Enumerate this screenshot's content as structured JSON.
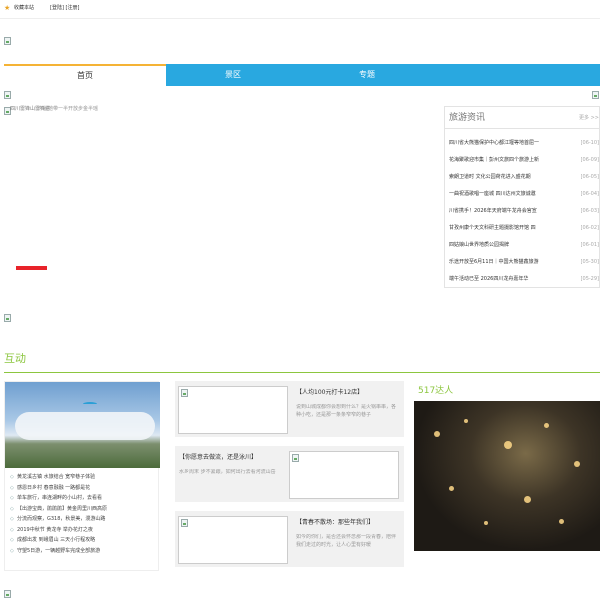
{
  "topbar": {
    "favorite_text": "收藏本站",
    "login_text": "[登陆] [注册]",
    "colors": {
      "favorite_icon": "#e9a426"
    }
  },
  "nav": {
    "items": [
      {
        "label": "首页",
        "active": true
      },
      {
        "label": "景区",
        "active": false
      },
      {
        "label": "专题",
        "active": false
      }
    ],
    "colors": {
      "background": "#29a8e0",
      "active_top": "#f5b335"
    }
  },
  "slider": {
    "caption": "四川雷锋山雷锋塔",
    "caption_b": "环谷地带一半开放步金半瑶"
  },
  "news": {
    "title": "旅游资讯",
    "more": "更多 >>",
    "items": [
      {
        "title": "四川省大熊猫保护中心都江堰等地首屈一",
        "date": "[06-10]"
      },
      {
        "title": "花海聚歌迎市集｜彭州文旅四个旅游上新",
        "date": "[06-09]"
      },
      {
        "title": "索朗卫道时 文化公园荷花进入盛花期",
        "date": "[06-05]"
      },
      {
        "title": "一曲祝酒歌唱一座城 四川达州文旅诚邀",
        "date": "[06-04]"
      },
      {
        "title": "川省携手！2026年天府端午龙舟会官宣",
        "date": "[06-03]"
      },
      {
        "title": "甘孜州康个天文科研主题摄影馆开馆 四",
        "date": "[06-02]"
      },
      {
        "title": "四姑娘山世界地质公园揭牌",
        "date": "[06-01]"
      },
      {
        "title": "乐途开放至6月11日｜中国大熊猫鑫旅游",
        "date": "[05-30]"
      },
      {
        "title": "端午活动已至 2026四川龙舟嘉年华",
        "date": "[05-29]"
      }
    ]
  },
  "interaction": {
    "title": "互动",
    "colors": {
      "accent": "#8cc63f"
    },
    "left_list": [
      "黄龙溪古镇 水旅结合 宽窄巷子体验",
      "感恩日乡村 春意融融 一路都是花",
      "单车旅行，串连湖畔的小山村，去看看",
      "【出游宝典，鹃鹃鹃】黄金周里川西高原",
      "分流而观察，G318，秋景美，漫游山路",
      "2019中秋节 黄龙寺 举办花灯之夜",
      "成都出发 到峨眉山 三天小行程攻略",
      "守望5日游，一辆越野车完成全部旅游"
    ],
    "mid_cards": [
      {
        "title": "【人均100元打卡12店】",
        "desc": "说到山城成都你会想到什么？是火锅串串，各种小吃，还是那一条条窄窄的巷子"
      },
      {
        "title": "【你愿意去做流，还是泳川】",
        "desc": "水乡周末 步不紧跟，如何出行去看河流山岳"
      },
      {
        "title": "【青春不散场：那些年我们】",
        "desc": "如今的你们，是否还会怀念那一段青春，陪伴我们走过的时光，让人心里有好暖"
      }
    ],
    "right_title": "517达人"
  }
}
